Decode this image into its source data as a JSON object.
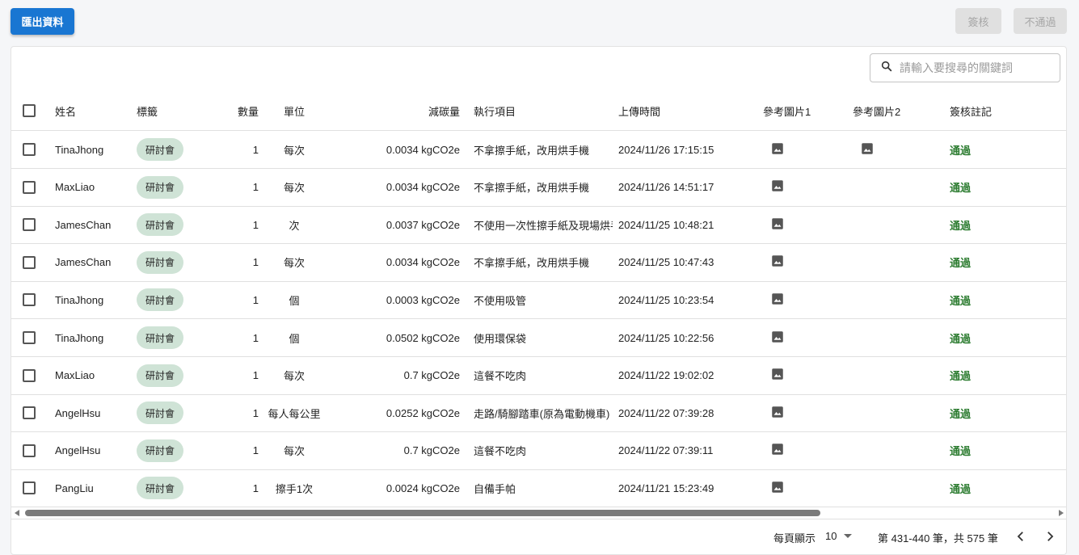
{
  "toolbar": {
    "export_label": "匯出資料",
    "approve_label": "簽核",
    "reject_label": "不通過"
  },
  "search": {
    "placeholder": "請輸入要搜尋的關鍵詞"
  },
  "columns": {
    "name": "姓名",
    "tag": "標籤",
    "quantity": "數量",
    "unit": "單位",
    "reduction": "減碳量",
    "item": "執行項目",
    "upload_time": "上傳時間",
    "image1": "參考圖片1",
    "image2": "參考圖片2",
    "note": "簽核註記"
  },
  "rows": [
    {
      "name": "TinaJhong",
      "tag": "研討會",
      "quantity": "1",
      "unit": "每次",
      "reduction": "0.0034 kgCO2e",
      "item": "不拿擦手紙，改用烘手機",
      "time": "2024/11/26 17:15:15",
      "image1": true,
      "image2": true,
      "note": "通過"
    },
    {
      "name": "MaxLiao",
      "tag": "研討會",
      "quantity": "1",
      "unit": "每次",
      "reduction": "0.0034 kgCO2e",
      "item": "不拿擦手紙，改用烘手機",
      "time": "2024/11/26 14:51:17",
      "image1": true,
      "image2": false,
      "note": "通過"
    },
    {
      "name": "JamesChan",
      "tag": "研討會",
      "quantity": "1",
      "unit": "次",
      "reduction": "0.0037 kgCO2e",
      "item": "不使用一次性擦手紙及現場烘手",
      "time": "2024/11/25 10:48:21",
      "image1": true,
      "image2": false,
      "note": "通過"
    },
    {
      "name": "JamesChan",
      "tag": "研討會",
      "quantity": "1",
      "unit": "每次",
      "reduction": "0.0034 kgCO2e",
      "item": "不拿擦手紙，改用烘手機",
      "time": "2024/11/25 10:47:43",
      "image1": true,
      "image2": false,
      "note": "通過"
    },
    {
      "name": "TinaJhong",
      "tag": "研討會",
      "quantity": "1",
      "unit": "個",
      "reduction": "0.0003 kgCO2e",
      "item": "不使用吸管",
      "time": "2024/11/25 10:23:54",
      "image1": true,
      "image2": false,
      "note": "通過"
    },
    {
      "name": "TinaJhong",
      "tag": "研討會",
      "quantity": "1",
      "unit": "個",
      "reduction": "0.0502 kgCO2e",
      "item": "使用環保袋",
      "time": "2024/11/25 10:22:56",
      "image1": true,
      "image2": false,
      "note": "通過"
    },
    {
      "name": "MaxLiao",
      "tag": "研討會",
      "quantity": "1",
      "unit": "每次",
      "reduction": "0.7 kgCO2e",
      "item": "這餐不吃肉",
      "time": "2024/11/22 19:02:02",
      "image1": true,
      "image2": false,
      "note": "通過"
    },
    {
      "name": "AngelHsu",
      "tag": "研討會",
      "quantity": "1",
      "unit": "每人每公里",
      "reduction": "0.0252 kgCO2e",
      "item": "走路/騎腳踏車(原為電動機車)",
      "time": "2024/11/22 07:39:28",
      "image1": true,
      "image2": false,
      "note": "通過"
    },
    {
      "name": "AngelHsu",
      "tag": "研討會",
      "quantity": "1",
      "unit": "每次",
      "reduction": "0.7 kgCO2e",
      "item": "這餐不吃肉",
      "time": "2024/11/22 07:39:11",
      "image1": true,
      "image2": false,
      "note": "通過"
    },
    {
      "name": "PangLiu",
      "tag": "研討會",
      "quantity": "1",
      "unit": "擦手1次",
      "reduction": "0.0024 kgCO2e",
      "item": "自備手帕",
      "time": "2024/11/21 15:23:49",
      "image1": true,
      "image2": false,
      "note": "通過"
    }
  ],
  "pagination": {
    "rows_per_page_label": "每頁顯示",
    "rows_per_page": "10",
    "range": "第 431-440 筆，共 575 筆"
  },
  "colors": {
    "primary": "#1976d2",
    "chip_bg": "#cfe3d6",
    "pass_text": "#2e7d32"
  }
}
